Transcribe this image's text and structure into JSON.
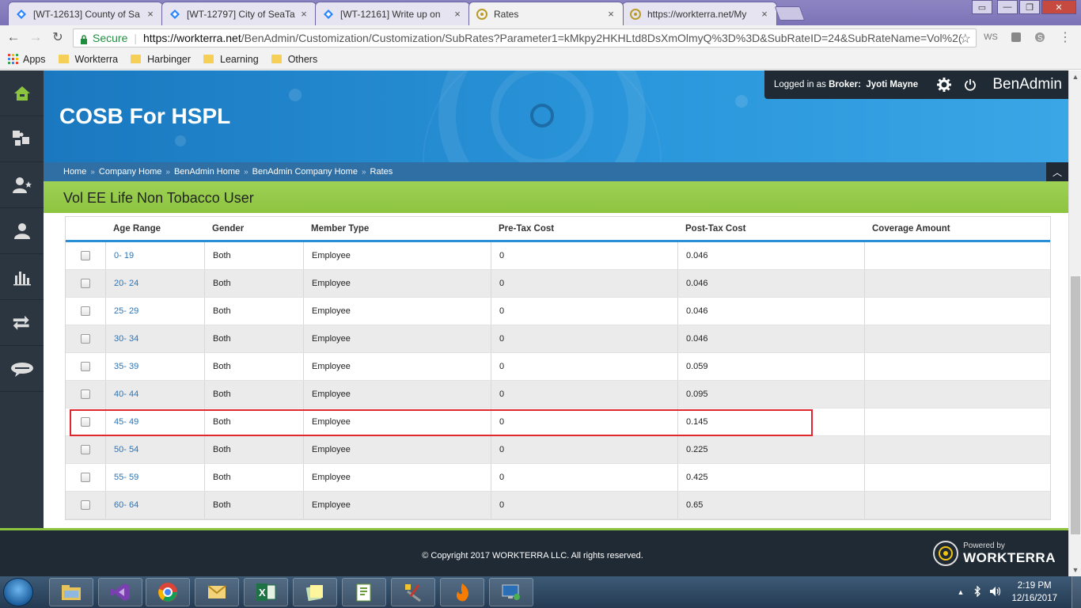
{
  "browser": {
    "tabs": [
      {
        "title": "[WT-12613] County of Sa",
        "icon": "jira-icon"
      },
      {
        "title": "[WT-12797] City of SeaTa",
        "icon": "jira-icon"
      },
      {
        "title": "[WT-12161] Write up on",
        "icon": "jira-icon"
      },
      {
        "title": "Rates",
        "icon": "workterra-icon",
        "active": true
      },
      {
        "title": "https://workterra.net/My",
        "icon": "workterra-icon"
      }
    ],
    "secure_label": "Secure",
    "url_host": "https://workterra.net",
    "url_path": "/BenAdmin/Customization/Customization/SubRates?Parameter1=kMkpy2HKHLtd8DsXmOlmyQ%3D%3D&SubRateID=24&SubRateName=Vol%2("
  },
  "bookmarks": {
    "apps_label": "Apps",
    "items": [
      "Workterra",
      "Harbinger",
      "Learning",
      "Others"
    ]
  },
  "header": {
    "company_title": "COSB For HSPL",
    "logged_in_prefix": "Logged in as",
    "role_label": "Broker:",
    "user_name": "Jyoti Mayne",
    "brand": "BenAdmin"
  },
  "breadcrumbs": [
    "Home",
    "Company Home",
    "BenAdmin Home",
    "BenAdmin Company Home",
    "Rates"
  ],
  "page_heading": "Vol EE Life Non Tobacco User",
  "table": {
    "columns": [
      "Age Range",
      "Gender",
      "Member Type",
      "Pre-Tax Cost",
      "Post-Tax Cost",
      "Coverage Amount"
    ],
    "rows": [
      {
        "age": "0- 19",
        "gender": "Both",
        "member": "Employee",
        "pre": "0",
        "post": "0.046",
        "coverage": ""
      },
      {
        "age": "20- 24",
        "gender": "Both",
        "member": "Employee",
        "pre": "0",
        "post": "0.046",
        "coverage": ""
      },
      {
        "age": "25- 29",
        "gender": "Both",
        "member": "Employee",
        "pre": "0",
        "post": "0.046",
        "coverage": ""
      },
      {
        "age": "30- 34",
        "gender": "Both",
        "member": "Employee",
        "pre": "0",
        "post": "0.046",
        "coverage": ""
      },
      {
        "age": "35- 39",
        "gender": "Both",
        "member": "Employee",
        "pre": "0",
        "post": "0.059",
        "coverage": ""
      },
      {
        "age": "40- 44",
        "gender": "Both",
        "member": "Employee",
        "pre": "0",
        "post": "0.095",
        "coverage": ""
      },
      {
        "age": "45- 49",
        "gender": "Both",
        "member": "Employee",
        "pre": "0",
        "post": "0.145",
        "coverage": ""
      },
      {
        "age": "50- 54",
        "gender": "Both",
        "member": "Employee",
        "pre": "0",
        "post": "0.225",
        "coverage": ""
      },
      {
        "age": "55- 59",
        "gender": "Both",
        "member": "Employee",
        "pre": "0",
        "post": "0.425",
        "coverage": ""
      },
      {
        "age": "60- 64",
        "gender": "Both",
        "member": "Employee",
        "pre": "0",
        "post": "0.65",
        "coverage": ""
      }
    ]
  },
  "footer": {
    "copyright": "© Copyright 2017 WORKTERRA LLC. All rights reserved.",
    "powered_by": "Powered by",
    "powered_brand": "WORKTERRA"
  },
  "taskbar": {
    "time": "2:19 PM",
    "date": "12/16/2017"
  },
  "colors": {
    "banner_blue": "#2b97dc",
    "green_bar": "#8cc43f",
    "dark_nav": "#2c3640",
    "highlight_red": "#e0262f",
    "link_blue": "#2a74b8"
  }
}
